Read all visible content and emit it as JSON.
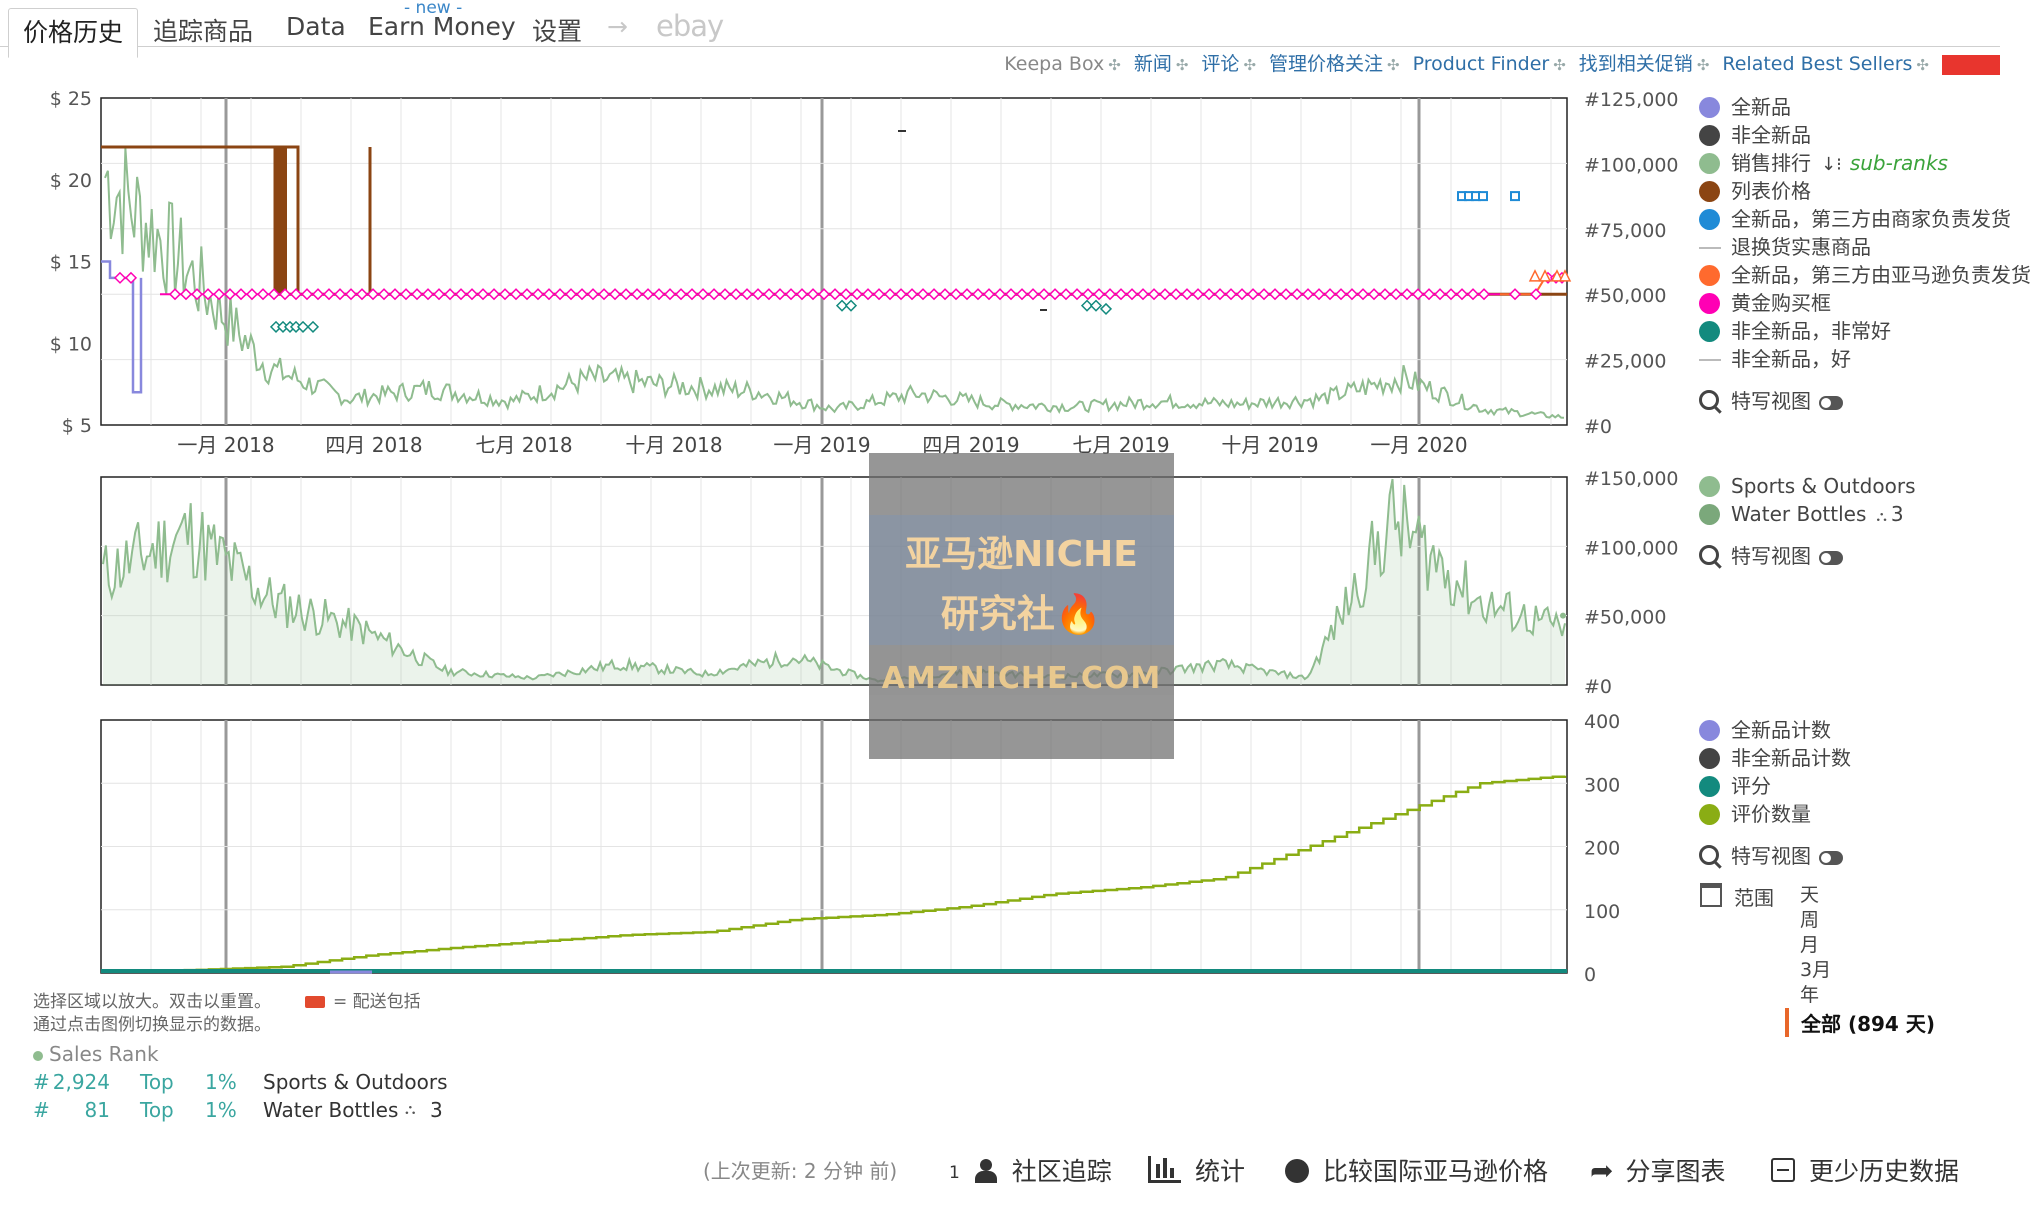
{
  "tabs": {
    "price_history": "价格历史",
    "tracked": "追踪商品",
    "data": "Data",
    "earn_money": "Earn Money",
    "new_badge": "- new -",
    "settings": "设置",
    "arrow": "→",
    "ebay": "ebay"
  },
  "links": [
    "Keepa Box",
    "新闻",
    "评论",
    "管理价格关注",
    "Product Finder",
    "找到相关促销",
    "Related Best Sellers"
  ],
  "colors": {
    "new": "#8888dd",
    "used": "#444444",
    "sales_rank": "#8fbc8f",
    "list_price": "#8b4513",
    "fba": "#1f8bd6",
    "warehouse": "#c0c0c0",
    "fbm": "#ff6a2e",
    "buy_box": "#ff00b4",
    "used_very_good": "#138a7e",
    "reviews": "#8aad14",
    "rating": "#138a7e"
  },
  "legend_main": [
    {
      "label": "全新品",
      "color": "#8888dd",
      "marker": "dot"
    },
    {
      "label": "非全新品",
      "color": "#444444",
      "marker": "dot"
    },
    {
      "label": "销售排行",
      "color": "#8fbc8f",
      "marker": "dot",
      "extra": "sub-ranks"
    },
    {
      "label": "列表价格",
      "color": "#8b4513",
      "marker": "dot"
    },
    {
      "label": "全新品，第三方由商家负责发货",
      "color": "#1f8bd6",
      "marker": "dot"
    },
    {
      "label": "退换货实惠商品",
      "color": "#c0c0c0",
      "marker": "dash"
    },
    {
      "label": "全新品，第三方由亚马逊负责发货",
      "color": "#ff6a2e",
      "marker": "dot"
    },
    {
      "label": "黄金购买框",
      "color": "#ff00b4",
      "marker": "dot"
    },
    {
      "label": "非全新品，非常好",
      "color": "#138a7e",
      "marker": "dot"
    },
    {
      "label": "非全新品，好",
      "color": "#c0c0c0",
      "marker": "dash"
    }
  ],
  "close_up_label": "特写视图",
  "legend_rank": [
    {
      "label": "Sports & Outdoors",
      "color": "#8fbc8f"
    },
    {
      "label": "Water Bottles",
      "color": "#7ba87b",
      "extra": "3"
    }
  ],
  "legend_counts": [
    {
      "label": "全新品计数",
      "color": "#8888dd"
    },
    {
      "label": "非全新品计数",
      "color": "#444444"
    },
    {
      "label": "评分",
      "color": "#138a7e"
    },
    {
      "label": "评价数量",
      "color": "#8aad14"
    }
  ],
  "range": {
    "label": "范围",
    "options": [
      "天",
      "周",
      "月",
      "3月",
      "年"
    ],
    "selected": "全部 (894 天)"
  },
  "hints": {
    "line1": "选择区域以放大。双击以重置。",
    "shipping": "= 配送包括",
    "line2": "通过点击图例切换显示的数据。"
  },
  "sales_rank_info": {
    "title": "Sales Rank",
    "rows": [
      {
        "hash": "#",
        "rank": "2,924",
        "top": "Top",
        "pct": "1%",
        "category": "Sports & Outdoors",
        "extra": ""
      },
      {
        "hash": "#",
        "rank": "81",
        "top": "Top",
        "pct": "1%",
        "category": "Water Bottles",
        "extra": "3"
      }
    ]
  },
  "watermark": {
    "line1": "亚马逊NICHE",
    "line2": "研究社🔥",
    "line3": "AMZNICHE.COM"
  },
  "footer": {
    "last_update": "(上次更新:  2 分钟 前)",
    "count": "1",
    "community": "社区追踪",
    "stats": "统计",
    "compare": "比较国际亚马逊价格",
    "share": "分享图表",
    "less_history": "更少历史数据"
  },
  "chart_data": [
    {
      "type": "line",
      "title": "",
      "x_ticks": [
        "一月 2018",
        "四月 2018",
        "七月 2018",
        "十月 2018",
        "一月 2019",
        "四月 2019",
        "七月 2019",
        "十月 2019",
        "一月 2020"
      ],
      "x_range": [
        "2017-10",
        "2020-04"
      ],
      "y_left": {
        "ticks": [
          "$ 25",
          "$ 20",
          "$ 15",
          "$ 10",
          "$ 5"
        ],
        "range": [
          5,
          25
        ]
      },
      "y_right": {
        "ticks": [
          "#125,000",
          "#100,000",
          "#75,000",
          "#50,000",
          "#25,000",
          "#0"
        ],
        "range": [
          0,
          125000
        ]
      },
      "series": [
        {
          "name": "黄金购买框",
          "values": [
            14,
            14,
            13,
            13,
            13,
            13,
            13,
            13,
            13,
            13,
            13,
            13,
            13,
            14
          ]
        },
        {
          "name": "列表价格",
          "values": [
            22,
            22,
            22,
            13,
            13
          ]
        },
        {
          "name": "全新品",
          "values": [
            15,
            14,
            7,
            14
          ]
        },
        {
          "name": "销售排行",
          "values": [
            95000,
            60000,
            22000,
            10000,
            14000,
            9000,
            18000,
            15000,
            13000,
            6000,
            12000,
            8000,
            7000,
            9000,
            8000,
            10000,
            18000,
            6000,
            3000
          ]
        },
        {
          "name": "非全新品，非常好",
          "values": [
            11,
            12.5,
            12.3
          ]
        },
        {
          "name": "全新品，第三方由商家负责发货",
          "values": [
            19,
            19
          ]
        },
        {
          "name": "全新品，第三方由亚马逊负责发货",
          "values": [
            13,
            14
          ]
        }
      ],
      "grid": true
    },
    {
      "type": "area",
      "y_right": {
        "ticks": [
          "#150,000",
          "#100,000",
          "#50,000",
          "#0"
        ],
        "range": [
          0,
          150000
        ]
      },
      "series": [
        {
          "name": "Sports & Outdoors",
          "values": [
            80000,
            110000,
            60000,
            40000,
            10000,
            5000,
            15000,
            8000,
            20000,
            3000,
            10000,
            6000,
            8000,
            15000,
            5000,
            120000,
            60000,
            40000
          ]
        }
      ],
      "grid": true
    },
    {
      "type": "line",
      "y_right": {
        "ticks": [
          "400",
          "300",
          "200",
          "100",
          "0"
        ],
        "range": [
          0,
          400
        ]
      },
      "series": [
        {
          "name": "评价数量",
          "values": [
            2,
            5,
            10,
            28,
            40,
            50,
            60,
            65,
            85,
            92,
            105,
            125,
            135,
            150,
            200,
            250,
            300,
            312
          ]
        },
        {
          "name": "评分",
          "values": [
            0,
            0,
            0
          ]
        }
      ],
      "grid": true
    }
  ]
}
